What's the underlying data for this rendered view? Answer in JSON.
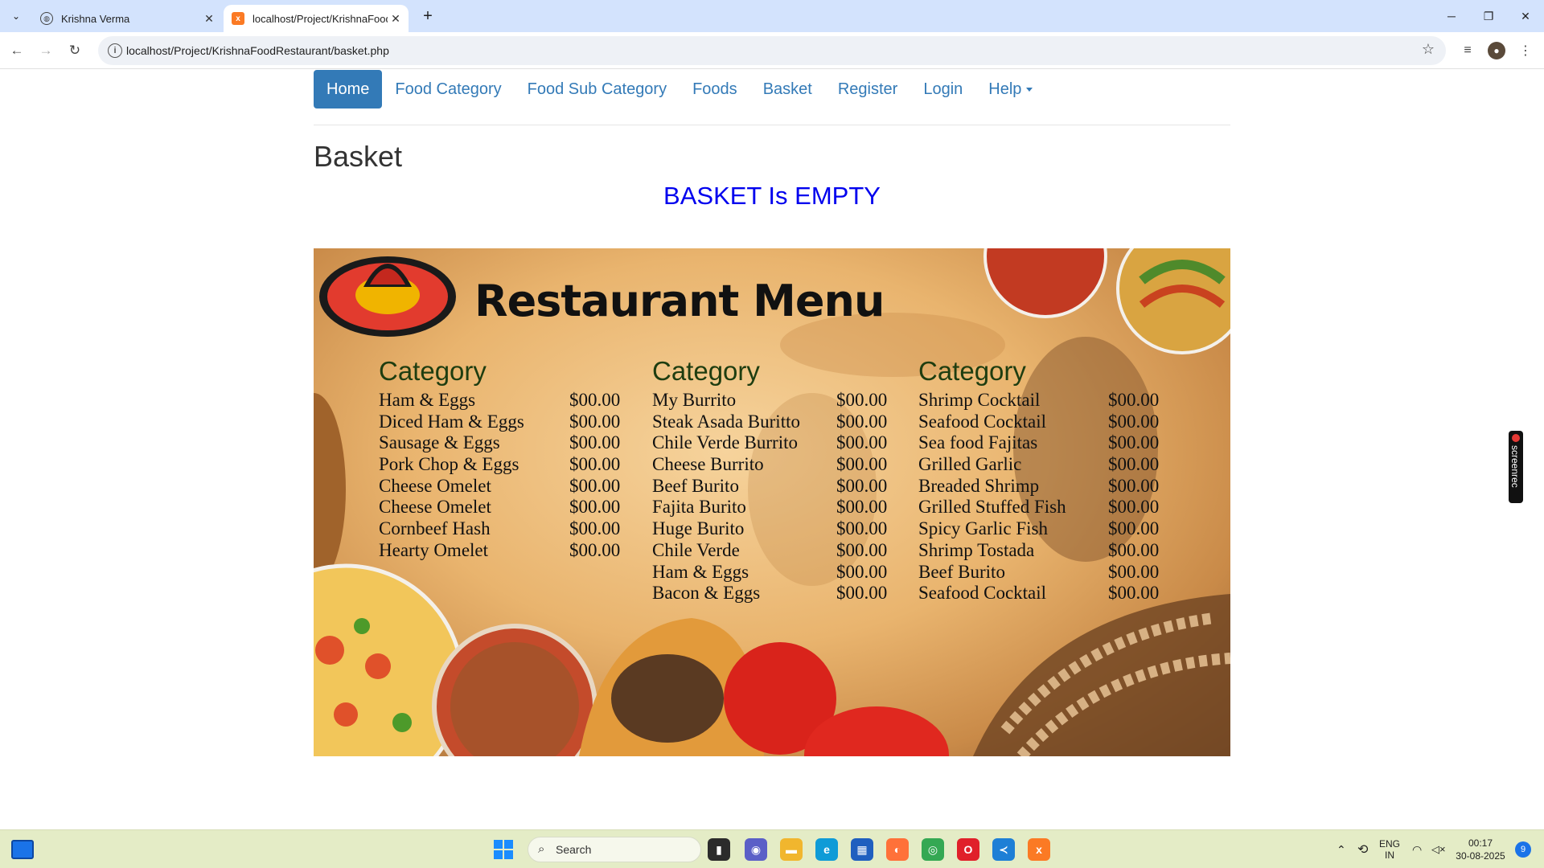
{
  "browser": {
    "tabs": [
      {
        "title": "Krishna Verma",
        "active": false
      },
      {
        "title": "localhost/Project/KrishnaFoodR",
        "active": true
      }
    ],
    "url": "localhost/Project/KrishnaFoodRestaurant/basket.php"
  },
  "nav": {
    "items": [
      {
        "label": "Home",
        "active": true
      },
      {
        "label": "Food Category"
      },
      {
        "label": "Food Sub Category"
      },
      {
        "label": "Foods"
      },
      {
        "label": "Basket"
      },
      {
        "label": "Register"
      },
      {
        "label": "Login"
      },
      {
        "label": "Help"
      }
    ]
  },
  "page": {
    "title": "Basket",
    "empty_message": "BASKET Is EMPTY"
  },
  "menu_image": {
    "title": "Restaurant Menu",
    "columns": [
      {
        "heading": "Category",
        "items": [
          {
            "name": "Ham & Eggs",
            "price": "$00.00"
          },
          {
            "name": "Diced Ham & Eggs",
            "price": "$00.00"
          },
          {
            "name": "Sausage & Eggs",
            "price": "$00.00"
          },
          {
            "name": "Pork Chop & Eggs",
            "price": "$00.00"
          },
          {
            "name": "Cheese Omelet",
            "price": "$00.00"
          },
          {
            "name": "Cheese Omelet",
            "price": "$00.00"
          },
          {
            "name": "Cornbeef Hash",
            "price": "$00.00"
          },
          {
            "name": "Hearty Omelet",
            "price": "$00.00"
          }
        ]
      },
      {
        "heading": "Category",
        "items": [
          {
            "name": "My Burrito",
            "price": "$00.00"
          },
          {
            "name": "Steak Asada Buritto",
            "price": "$00.00"
          },
          {
            "name": "Chile Verde Burrito",
            "price": "$00.00"
          },
          {
            "name": "Cheese Burrito",
            "price": "$00.00"
          },
          {
            "name": "Beef Burito",
            "price": "$00.00"
          },
          {
            "name": "Fajita Burito",
            "price": "$00.00"
          },
          {
            "name": "Huge Burito",
            "price": "$00.00"
          },
          {
            "name": "Chile Verde",
            "price": "$00.00"
          },
          {
            "name": "Ham & Eggs",
            "price": "$00.00"
          },
          {
            "name": "Bacon & Eggs",
            "price": "$00.00"
          }
        ]
      },
      {
        "heading": "Category",
        "items": [
          {
            "name": "Shrimp Cocktail",
            "price": "$00.00"
          },
          {
            "name": "Seafood Cocktail",
            "price": "$00.00"
          },
          {
            "name": "Sea food Fajitas",
            "price": "$00.00"
          },
          {
            "name": "Grilled Garlic",
            "price": "$00.00"
          },
          {
            "name": "Breaded Shrimp",
            "price": "$00.00"
          },
          {
            "name": "Grilled Stuffed Fish",
            "price": "$00.00"
          },
          {
            "name": "Spicy Garlic Fish",
            "price": "$00.00"
          },
          {
            "name": "Shrimp Tostada",
            "price": "$00.00"
          },
          {
            "name": "Beef Burito",
            "price": "$00.00"
          },
          {
            "name": "Seafood Cocktail",
            "price": "$00.00"
          }
        ]
      }
    ]
  },
  "screenrec": {
    "label": "screenrec"
  },
  "taskbar": {
    "search_placeholder": "Search",
    "lang_top": "ENG",
    "lang_bottom": "IN",
    "time": "00:17",
    "date": "30-08-2025",
    "notification_count": "9"
  },
  "colors": {
    "nav_link": "#337ab7",
    "nav_active_bg": "#337ab7",
    "empty_message": "#0000ee",
    "tabbar": "#d3e3fd",
    "taskbar": "#e4ecc6"
  }
}
